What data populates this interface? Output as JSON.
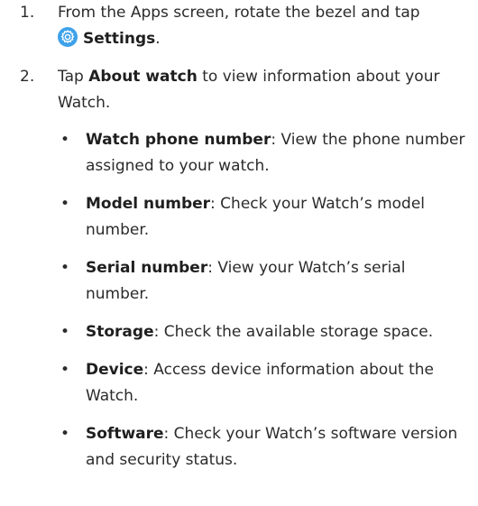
{
  "steps": [
    {
      "number": "1.",
      "text_before": "From the Apps screen, rotate the bezel and tap",
      "icon": "settings-gear-icon",
      "bold": "Settings",
      "text_after": "."
    },
    {
      "number": "2.",
      "text_before": "Tap",
      "bold": "About watch",
      "text_after": "to view information about your Watch."
    }
  ],
  "bullets": [
    {
      "term": "Watch phone number",
      "desc": ": View the phone number assigned to your watch."
    },
    {
      "term": "Model number",
      "desc": ": Check your Watch’s model number."
    },
    {
      "term": "Serial number",
      "desc": ": View your Watch’s serial number."
    },
    {
      "term": "Storage",
      "desc": ": Check the available storage space."
    },
    {
      "term": "Device",
      "desc": ": Access device information about the Watch."
    },
    {
      "term": "Software",
      "desc": ": Check your Watch’s software version and security status."
    }
  ],
  "bullet_char": "•",
  "colors": {
    "icon_bg": "#3ea1ea",
    "text": "#2b2b2b"
  }
}
